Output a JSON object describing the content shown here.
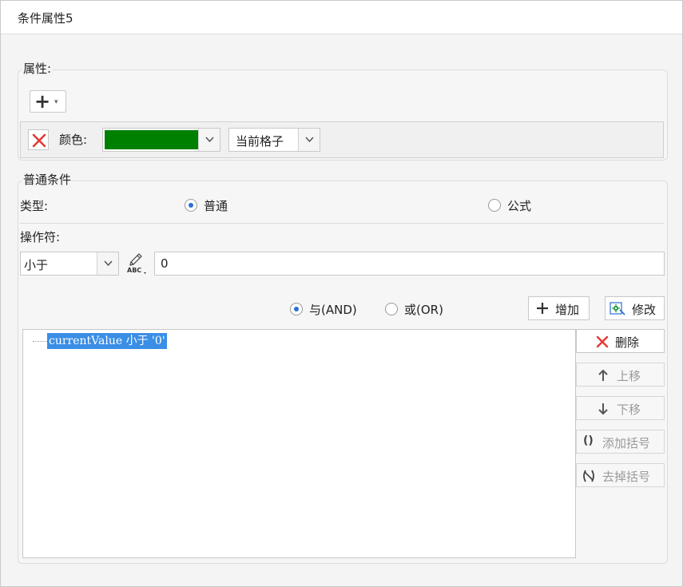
{
  "window": {
    "title": "条件属性5"
  },
  "properties": {
    "legend": "属性:",
    "add_label": "+",
    "color_label": "颜色:",
    "color_value": "#008000",
    "scope_value": "当前格子"
  },
  "conditions": {
    "legend": "普通条件",
    "type_label": "类型:",
    "type_options": [
      "普通",
      "公式"
    ],
    "type_selected": "普通",
    "operator_label": "操作符:",
    "operator_value": "小于",
    "value": "0",
    "logic_options": [
      "与(AND)",
      "或(OR)"
    ],
    "logic_selected": "与(AND)",
    "add_button": "增加",
    "modify_button": "修改",
    "delete_button": "删除",
    "move_up_button": "上移",
    "move_down_button": "下移",
    "add_bracket_button": "添加括号",
    "remove_bracket_button": "去掉括号",
    "items": [
      "currentValue 小于 '0'"
    ]
  },
  "colors": {
    "accent": "#2a6fd6",
    "selection": "#3a8ee6",
    "delete_red": "#e53935",
    "modify_green": "#2f9e44"
  }
}
